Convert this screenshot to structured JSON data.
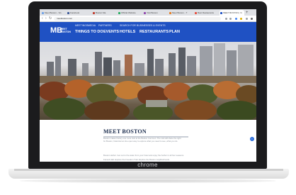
{
  "browser": {
    "tabs": [
      {
        "label": "Meet Boston - Vis",
        "active": false,
        "favicon_color": "#6fa1e6"
      },
      {
        "label": "Facebook",
        "active": false,
        "favicon_color": "#3b5998"
      },
      {
        "label": "Boston Ma",
        "active": false,
        "favicon_color": "#c0392b"
      },
      {
        "label": "Official Website",
        "active": false,
        "favicon_color": "#27ae60"
      },
      {
        "label": "Visit Boston",
        "active": false,
        "favicon_color": "#8e44ad"
      },
      {
        "label": "Meet Boston - T",
        "active": false,
        "favicon_color": "#e67e22"
      },
      {
        "label": "Best Restaurants",
        "active": false,
        "favicon_color": "#e74c3c"
      },
      {
        "label": "MEET BOSTON | Vi",
        "active": true,
        "favicon_color": "#1f51c3"
      }
    ],
    "new_tab_icon": "plus",
    "url": "meetboston.com",
    "back_icon": "back-arrow",
    "forward_icon": "forward-arrow",
    "reload_icon": "reload"
  },
  "site": {
    "logo_text": "MB",
    "logo_sub": "MEET BOSTON",
    "utility_links": [
      "MEETINGS",
      "MEDIA",
      "PARTNERS"
    ],
    "utility_right": "SEARCH FOR BUSINESSES & EVENTS",
    "nav": [
      "THINGS TO DO",
      "EVENTS",
      "HOTELS",
      "RESTAURANTS",
      "PLAN"
    ],
    "brand_color": "#1f51c3"
  },
  "content": {
    "title": "MEET BOSTON",
    "para1a": "Boston makes history one more visit at the Boston Common. The visit will share the right",
    "para1b": "for Boston, historical on-line open way to explore what you need to see, what you do.",
    "para2": "Boston Harbor. Get out to the water from your hotel and enjoy the harbor in all four seasons.",
    "para3": "Faneuil Hall. Explore the Freedom Trail. Explore the Boston neighborhoods.",
    "helper_icon": "info"
  },
  "device": {
    "brand": "chrome"
  }
}
